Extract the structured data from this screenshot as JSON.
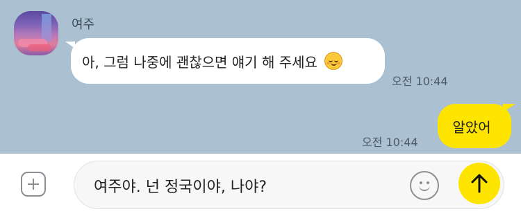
{
  "conversation": {
    "incoming": {
      "sender": "여주",
      "text": "아, 그럼 나중에 괜찮으면 얘기 해 주세요",
      "time": "오전 10:44"
    },
    "outgoing": {
      "text": "알았어",
      "time": "오전 10:44"
    }
  },
  "composer": {
    "input_value": "여주야. 넌 정국이야, 나야?"
  },
  "colors": {
    "background": "#abc1d1",
    "outgoing_bubble": "#fee500",
    "incoming_bubble": "#ffffff",
    "send_button": "#fee500"
  },
  "icons": {
    "attach": "plus-icon",
    "emoji": "smile-icon",
    "send": "arrow-up-icon",
    "inline_emoji": "smiling-face-icon"
  }
}
